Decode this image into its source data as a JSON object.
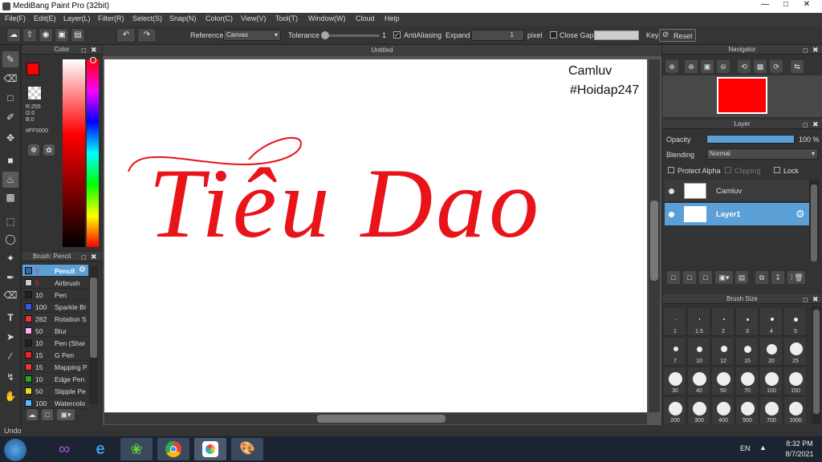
{
  "window": {
    "title": "MediBang Paint Pro (32bit)"
  },
  "menu": [
    "File(F)",
    "Edit(E)",
    "Layer(L)",
    "Filter(R)",
    "Select(S)",
    "Snap(N)",
    "Color(C)",
    "View(V)",
    "Tool(T)",
    "Window(W)",
    "Cloud",
    "Help"
  ],
  "toolbar": {
    "reference_label": "Reference",
    "reference_value": "Canvas",
    "tolerance_label": "Tolerance",
    "tolerance_value": "1",
    "antialiasing_label": "AntiAliasing",
    "expand_label": "Expand",
    "expand_value": "1",
    "expand_unit": "pixel",
    "close_gaps_label": "Close Gaps",
    "key_label": "Key",
    "reset_label": "Reset"
  },
  "color_panel": {
    "title": "Color",
    "r": "R:255",
    "g": "G:0",
    "b": "B:0",
    "hex": "#FF0000",
    "fg_color": "#ff0000"
  },
  "brush_panel": {
    "title": "Brush: Pencil",
    "items": [
      {
        "size": "5",
        "name": "Pencil",
        "color": "#2f6ab1"
      },
      {
        "size": "5",
        "name": "Airbrush",
        "color": "#cccccc"
      },
      {
        "size": "10",
        "name": "Pen",
        "color": "#222222"
      },
      {
        "size": "100",
        "name": "Sparkle Br",
        "color": "#3355ee"
      },
      {
        "size": "282",
        "name": "Rotation S",
        "color": "#ee3333"
      },
      {
        "size": "50",
        "name": "Blur",
        "color": "#ffaaee"
      },
      {
        "size": "10",
        "name": "Pen (Shar",
        "color": "#222222"
      },
      {
        "size": "15",
        "name": "G Pen",
        "color": "#ee2222"
      },
      {
        "size": "15",
        "name": "Mapping P",
        "color": "#ee3333"
      },
      {
        "size": "10",
        "name": "Edge Pen",
        "color": "#22aa22"
      },
      {
        "size": "50",
        "name": "Stipple Pe",
        "color": "#dddd22"
      },
      {
        "size": "100",
        "name": "Watercolo",
        "color": "#55bbff"
      }
    ]
  },
  "document": {
    "tab_title": "Untitled"
  },
  "canvas": {
    "watermark_line1": "Camluv",
    "watermark_line2": "#Hoidap247",
    "script_text": "Tiêu Dao"
  },
  "navigator": {
    "title": "Navigator"
  },
  "layer_panel": {
    "title": "Layer",
    "opacity_label": "Opacity",
    "opacity_value": "100 %",
    "opacity_fraction": 1.0,
    "blending_label": "Blending",
    "blending_value": "Normal",
    "protect_alpha_label": "Protect Alpha",
    "clipping_label": "Clipping",
    "lock_label": "Lock",
    "layers": [
      {
        "name": "Camluv",
        "selected": false
      },
      {
        "name": "Layer1",
        "selected": true
      }
    ]
  },
  "brush_size_panel": {
    "title": "Brush Size",
    "sizes": [
      "1",
      "1.5",
      "2",
      "3",
      "4",
      "5",
      "7",
      "10",
      "12",
      "15",
      "20",
      "25",
      "30",
      "40",
      "50",
      "70",
      "100",
      "150",
      "200",
      "300",
      "400",
      "500",
      "700",
      "1000"
    ]
  },
  "status": {
    "text": "Undo"
  },
  "taskbar": {
    "language": "EN",
    "time": "8:32 PM",
    "date": "8/7/2021"
  }
}
